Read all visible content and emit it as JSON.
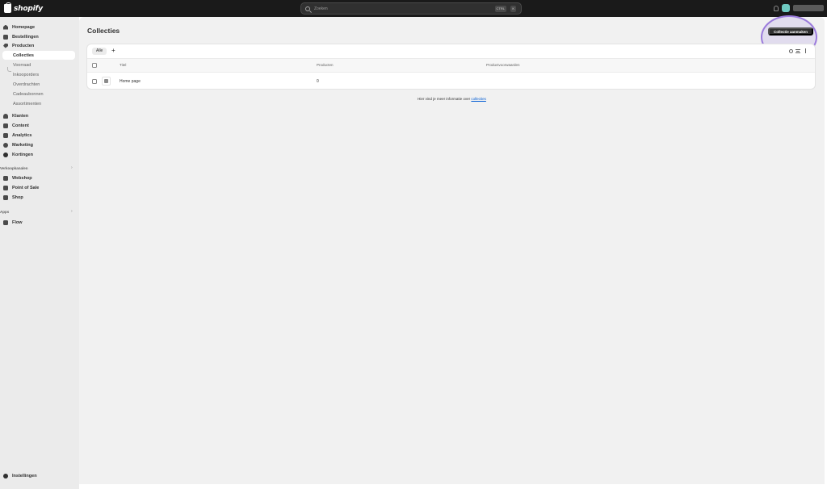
{
  "topbar": {
    "logo_text": "shopify",
    "search_placeholder": "Zoeken",
    "shortcut_ctrl": "CTRL",
    "shortcut_key": "K"
  },
  "sidebar": {
    "items": [
      {
        "label": "Homepage",
        "icon": "home-icon"
      },
      {
        "label": "Bestellingen",
        "icon": "inbox-icon"
      },
      {
        "label": "Producten",
        "icon": "tag-icon"
      },
      {
        "label": "Collecties",
        "icon": "",
        "active": true
      }
    ],
    "product_subitems": [
      "Voorraad",
      "Inkooporders",
      "Overdrachten",
      "Cadeaubonnen",
      "Assortimenten"
    ],
    "items2": [
      {
        "label": "Klanten",
        "icon": "person-icon"
      },
      {
        "label": "Content",
        "icon": "content-icon"
      },
      {
        "label": "Analytics",
        "icon": "analytics-icon"
      },
      {
        "label": "Marketing",
        "icon": "marketing-icon"
      },
      {
        "label": "Kortingen",
        "icon": "discount-icon"
      }
    ],
    "sales_channels_label": "Verkoopkanalen",
    "sales_channels": [
      {
        "label": "Webshop",
        "icon": "store-icon"
      },
      {
        "label": "Point of Sale",
        "icon": "pos-icon"
      },
      {
        "label": "Shop",
        "icon": "shop-icon"
      }
    ],
    "apps_label": "Apps",
    "apps": [
      {
        "label": "Flow",
        "icon": "flow-icon"
      }
    ],
    "settings_label": "Instellingen",
    "chevron": "›"
  },
  "main": {
    "title": "Collecties",
    "create_button": "Collectie aanmaken",
    "tabs": [
      {
        "label": "Alle"
      }
    ],
    "add_tab": "+",
    "columns": {
      "title": "Titel",
      "products": "Producten",
      "conditions": "Productvoorwaarden"
    },
    "rows": [
      {
        "title": "Home page",
        "products": "0",
        "conditions": ""
      }
    ],
    "footer_text": "Meer informatie over",
    "footer_prefix": "Hier vind je meer informatie over",
    "footer_link": "collecties"
  },
  "colors": {
    "topbar": "#1a1a1a",
    "sidebar": "#ebebeb",
    "main_bg": "#f1f1f1",
    "primary_button": "#303030",
    "highlight": "#9b7bdc",
    "link": "#005bd3"
  }
}
